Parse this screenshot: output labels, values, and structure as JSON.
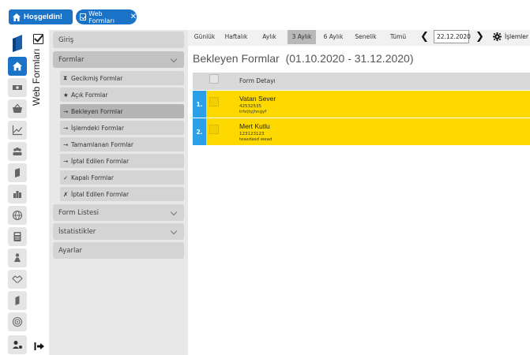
{
  "header": {
    "home_label": "Hoşgeldin!",
    "tabs": [
      {
        "label": "Web Formları"
      }
    ],
    "close_icon": "close-icon"
  },
  "rail": {
    "icons": [
      "logo-icon",
      "home-icon",
      "money-icon",
      "basket-icon",
      "chart-line-icon",
      "users-icon",
      "document-icon",
      "buildings-icon",
      "globe-icon",
      "calculator-icon",
      "org-chart-icon",
      "handshake-icon",
      "file-icon",
      "target-icon",
      "user-settings-icon"
    ],
    "active": "home-icon"
  },
  "module": {
    "title": "Web Formları"
  },
  "menu": {
    "giris": "Giriş",
    "formlar": "Formlar",
    "items": [
      {
        "marker": "⧗",
        "label": "Gecikmiş Formlar"
      },
      {
        "marker": "★",
        "label": "Açık Formlar"
      },
      {
        "marker": "→",
        "label": "Bekleyen Formlar"
      },
      {
        "marker": "→",
        "label": "İşlemdeki Formlar"
      },
      {
        "marker": "→",
        "label": "Tamamlanan Formlar"
      },
      {
        "marker": "→",
        "label": "İptal Edilen Formlar"
      },
      {
        "marker": "✓",
        "label": "Kapalı Formlar"
      },
      {
        "marker": "✗",
        "label": "İptal Edilen Formlar"
      }
    ],
    "selected_index": 2,
    "form_listesi": "Form Listesi",
    "istatistikler": "İstatistikler",
    "ayarlar": "Ayarlar"
  },
  "periods": {
    "items": [
      "Günlük",
      "Haftalık",
      "Aylık",
      "3 Aylık",
      "6 Aylık",
      "Senelik",
      "Tümü"
    ],
    "selected": "3 Aylık",
    "date": "22.12.2020",
    "actions_label": "İşlemler"
  },
  "content": {
    "title": "Bekleyen Formlar",
    "range": "(01.10.2020 - 31.12.2020)",
    "column_header": "Form Detayı",
    "rows": [
      {
        "num": "1.",
        "name": "Vatan Sever",
        "line1": "42532535",
        "line2": "trhrjtyjhngyf"
      },
      {
        "num": "2.",
        "name": "Mert Kutlu",
        "line1": "123123123",
        "line2": "teasdasd wead"
      }
    ]
  },
  "colors": {
    "accent": "#1b73c8",
    "row_highlight": "#fdd900",
    "row_number": "#2d9ee8"
  }
}
